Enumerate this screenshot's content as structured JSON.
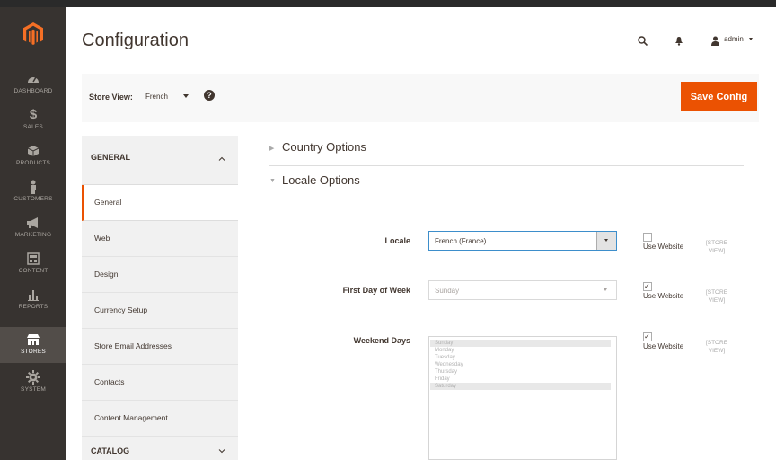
{
  "sidebar": {
    "logo_icon": "magento-logo-icon",
    "items": [
      {
        "label": "DASHBOARD",
        "icon": "dashboard-icon"
      },
      {
        "label": "SALES",
        "icon": "dollar-icon"
      },
      {
        "label": "PRODUCTS",
        "icon": "cube-icon"
      },
      {
        "label": "CUSTOMERS",
        "icon": "person-icon"
      },
      {
        "label": "MARKETING",
        "icon": "megaphone-icon"
      },
      {
        "label": "CONTENT",
        "icon": "layout-icon"
      },
      {
        "label": "REPORTS",
        "icon": "bar-chart-icon"
      },
      {
        "label": "STORES",
        "icon": "store-icon",
        "active": true
      },
      {
        "label": "SYSTEM",
        "icon": "gear-icon"
      }
    ]
  },
  "header": {
    "title": "Configuration",
    "user": "admin",
    "icons": [
      "search-icon",
      "bell-icon",
      "user-icon"
    ]
  },
  "store_view": {
    "label": "Store View:",
    "value": "French",
    "save_label": "Save Config",
    "help": "?"
  },
  "tabs": {
    "general_group": "GENERAL",
    "catalog_group": "CATALOG",
    "items": [
      "General",
      "Web",
      "Design",
      "Currency Setup",
      "Store Email Addresses",
      "Contacts",
      "Content Management"
    ]
  },
  "sections": {
    "country_options": "Country Options",
    "locale_options": "Locale Options"
  },
  "fields": {
    "locale": {
      "label": "Locale",
      "value": "French (France)",
      "use_website": "Use Website",
      "scope": "[STORE VIEW]",
      "use_website_checked": false
    },
    "first_day": {
      "label": "First Day of Week",
      "value": "Sunday",
      "use_website": "Use Website",
      "scope": "[STORE VIEW]",
      "use_website_checked": true
    },
    "weekend_days": {
      "label": "Weekend Days",
      "options": [
        "Sunday",
        "Monday",
        "Tuesday",
        "Wednesday",
        "Thursday",
        "Friday",
        "Saturday"
      ],
      "selected": [
        0,
        6
      ],
      "use_website": "Use Website",
      "scope": "[STORE VIEW]",
      "use_website_checked": true
    }
  },
  "colors": {
    "accent": "#eb5202",
    "sidebar_bg": "#373330",
    "text": "#41362f"
  }
}
